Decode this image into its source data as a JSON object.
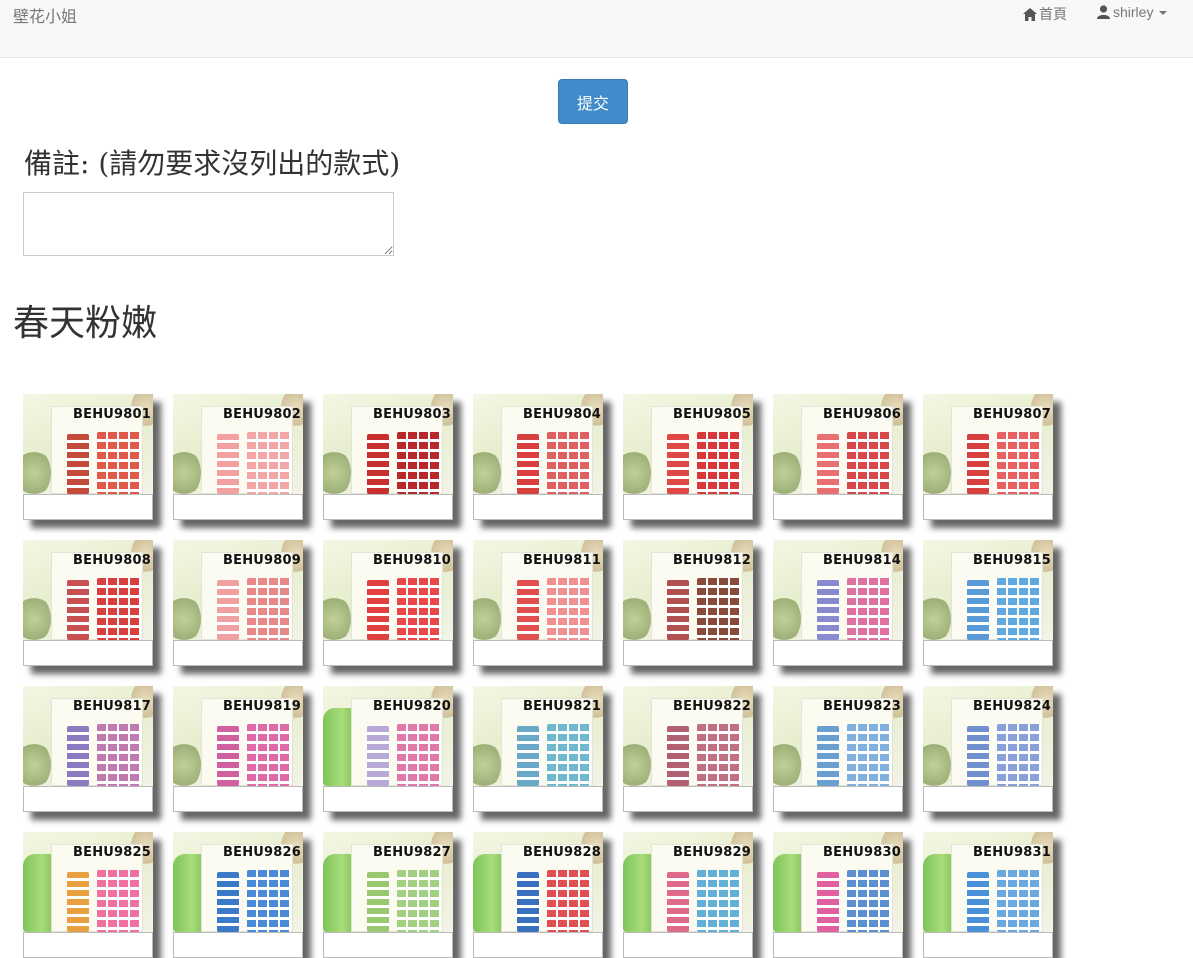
{
  "navbar": {
    "brand": "壁花小姐",
    "home_label": "首頁",
    "user_label": "shirley"
  },
  "form": {
    "submit_label": "提交",
    "notes_label": "備註: (請勿要求沒列出的款式)",
    "notes_value": ""
  },
  "section": {
    "title": "春天粉嫩"
  },
  "products": [
    {
      "code": "BEHU9801",
      "c1": "#c44a3a",
      "c2": "#e05a4a"
    },
    {
      "code": "BEHU9802",
      "c1": "#f2a0a0",
      "c2": "#f4a6a6"
    },
    {
      "code": "BEHU9803",
      "c1": "#c83030",
      "c2": "#b82a2a"
    },
    {
      "code": "BEHU9804",
      "c1": "#d84040",
      "c2": "#e06060"
    },
    {
      "code": "BEHU9805",
      "c1": "#e04848",
      "c2": "#d83838"
    },
    {
      "code": "BEHU9806",
      "c1": "#e87070",
      "c2": "#d84848"
    },
    {
      "code": "BEHU9807",
      "c1": "#d84040",
      "c2": "#e86060"
    },
    {
      "code": "BEHU9808",
      "c1": "#c85050",
      "c2": "#d84040"
    },
    {
      "code": "BEHU9809",
      "c1": "#f0a0a0",
      "c2": "#e88888"
    },
    {
      "code": "BEHU9810",
      "c1": "#e04040",
      "c2": "#e84848"
    },
    {
      "code": "BEHU9811",
      "c1": "#e05050",
      "c2": "#f09090"
    },
    {
      "code": "BEHU9812",
      "c1": "#b05050",
      "c2": "#8a4a3a"
    },
    {
      "code": "BEHU9814",
      "c1": "#8a8ad0",
      "c2": "#e070a0"
    },
    {
      "code": "BEHU9815",
      "c1": "#5a9ad8",
      "c2": "#60a8e0"
    },
    {
      "code": "BEHU9817",
      "c1": "#8a7ac0",
      "c2": "#c07ab0"
    },
    {
      "code": "BEHU9819",
      "c1": "#d060a0",
      "c2": "#e06aa8"
    },
    {
      "code": "BEHU9820",
      "c1": "#b8a8d8",
      "c2": "#e078a8"
    },
    {
      "code": "BEHU9821",
      "c1": "#6aa8c8",
      "c2": "#70b8d0"
    },
    {
      "code": "BEHU9822",
      "c1": "#b06070",
      "c2": "#c07080"
    },
    {
      "code": "BEHU9823",
      "c1": "#6aa0d0",
      "c2": "#80b0e0"
    },
    {
      "code": "BEHU9824",
      "c1": "#7090d0",
      "c2": "#8aa0d8"
    },
    {
      "code": "BEHU9825",
      "c1": "#e8a040",
      "c2": "#f070a0"
    },
    {
      "code": "BEHU9826",
      "c1": "#3a78c8",
      "c2": "#4a88d8"
    },
    {
      "code": "BEHU9827",
      "c1": "#9ac870",
      "c2": "#a0d080"
    },
    {
      "code": "BEHU9828",
      "c1": "#3a70c0",
      "c2": "#e05050"
    },
    {
      "code": "BEHU9829",
      "c1": "#e06a8a",
      "c2": "#60b0d8"
    },
    {
      "code": "BEHU9830",
      "c1": "#e060a0",
      "c2": "#5a90d0"
    },
    {
      "code": "BEHU9831",
      "c1": "#4a90d8",
      "c2": "#6aa8e0"
    }
  ]
}
